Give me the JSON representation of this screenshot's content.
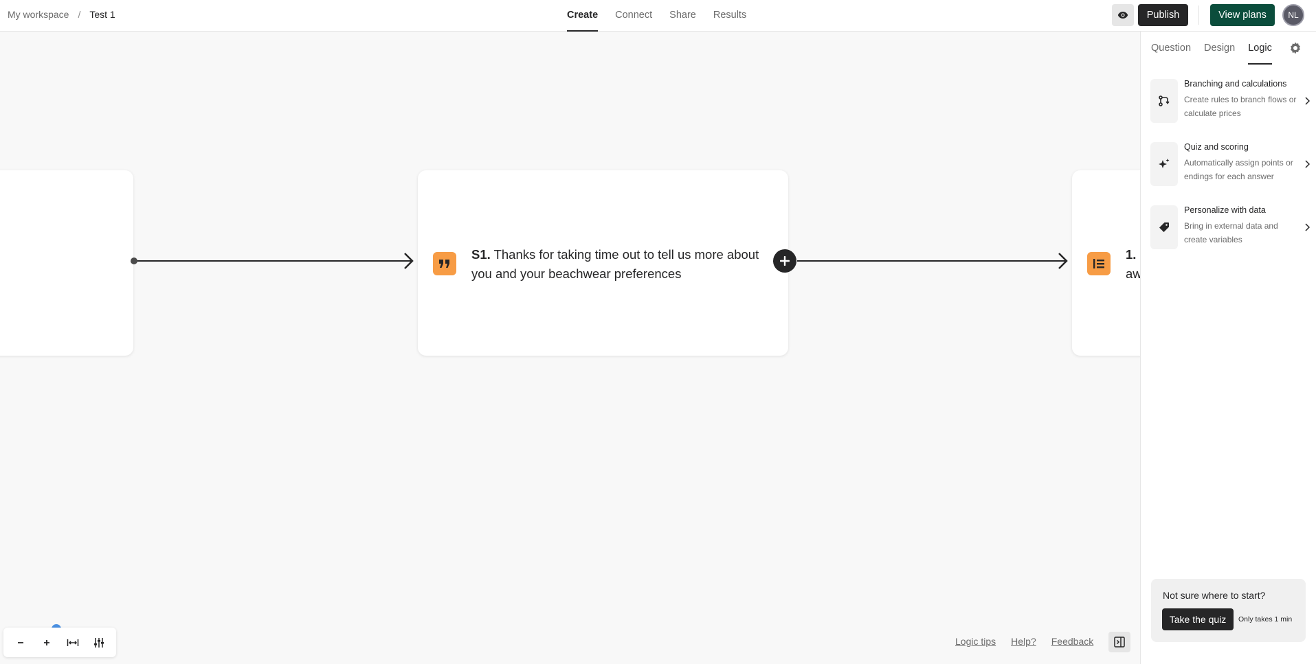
{
  "header": {
    "breadcrumb": {
      "workspace": "My workspace",
      "separator": "/",
      "form": "Test 1"
    },
    "tabs": [
      {
        "label": "Create",
        "active": true
      },
      {
        "label": "Connect",
        "active": false
      },
      {
        "label": "Share",
        "active": false
      },
      {
        "label": "Results",
        "active": false
      }
    ],
    "preview_icon": "eye-icon",
    "publish_label": "Publish",
    "plans_label": "View plans",
    "avatar_initials": "NL"
  },
  "canvas": {
    "cards": [
      {
        "number": "S1.",
        "text": "Thanks for taking time out to tell us more about you and your beachwear preferences",
        "icon": "quote-icon"
      },
      {
        "number": "1.",
        "text": "aw",
        "icon": "list-icon"
      }
    ],
    "add_icon": "plus-icon"
  },
  "zoom_controls": [
    {
      "icon": "zoom-out-icon",
      "glyph": "−"
    },
    {
      "icon": "zoom-in-icon",
      "glyph": "+"
    },
    {
      "icon": "fit-width-icon"
    },
    {
      "icon": "settings-sliders-icon"
    }
  ],
  "footer_links": [
    "Logic tips",
    "Help?",
    "Feedback"
  ],
  "panel": {
    "tabs": [
      {
        "label": "Question",
        "active": false
      },
      {
        "label": "Design",
        "active": false
      },
      {
        "label": "Logic",
        "active": true
      }
    ],
    "logic_items": [
      {
        "title": "Branching and calculations",
        "desc": "Create rules to branch flows or calculate prices",
        "icon": "branch-icon"
      },
      {
        "title": "Quiz and scoring",
        "desc": "Automatically assign points or endings for each answer",
        "icon": "sparkle-icon"
      },
      {
        "title": "Personalize with data",
        "desc": "Bring in external data and create variables",
        "icon": "tag-icon"
      }
    ],
    "help": {
      "text": "Not sure where to start?",
      "button": "Take the quiz",
      "note": "Only takes 1 min"
    }
  },
  "colors": {
    "accent_green": "#0b4d3c",
    "question_icon_orange": "#f79c45",
    "dark": "#262627"
  }
}
